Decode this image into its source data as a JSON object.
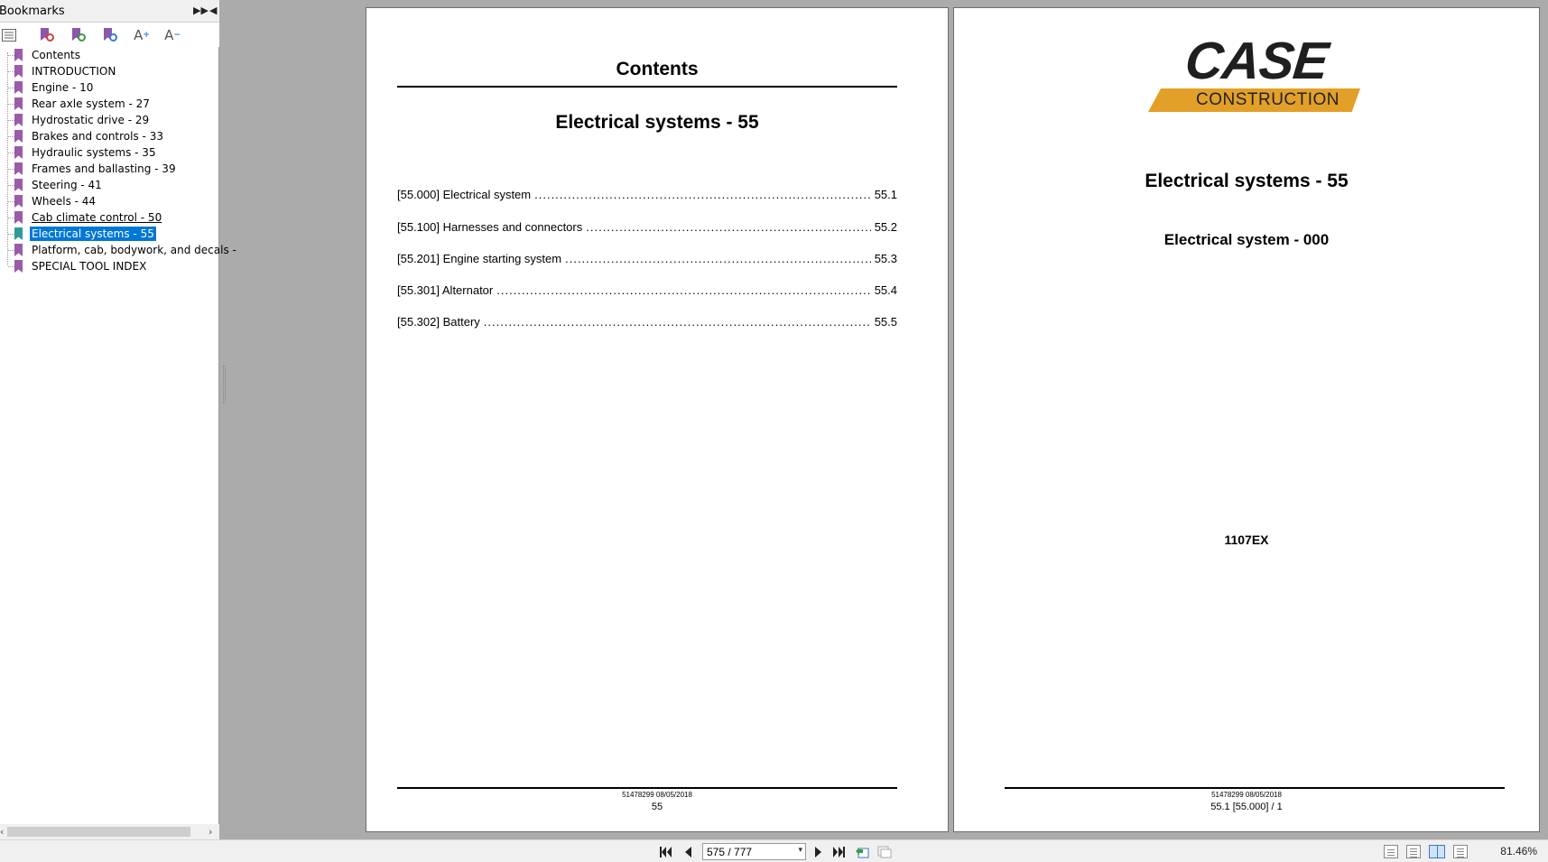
{
  "sidebar": {
    "title": "Bookmarks",
    "items": [
      {
        "label": "Contents"
      },
      {
        "label": "INTRODUCTION"
      },
      {
        "label": "Engine - 10"
      },
      {
        "label": "Rear axle system - 27"
      },
      {
        "label": "Hydrostatic drive - 29"
      },
      {
        "label": "Brakes and controls - 33"
      },
      {
        "label": "Hydraulic systems - 35"
      },
      {
        "label": "Frames and ballasting - 39"
      },
      {
        "label": "Steering - 41"
      },
      {
        "label": "Wheels - 44"
      },
      {
        "label": "Cab climate control - 50"
      },
      {
        "label": "Electrical systems - 55"
      },
      {
        "label": "Platform, cab, bodywork, and decals -"
      },
      {
        "label": "SPECIAL TOOL INDEX"
      }
    ]
  },
  "left_page": {
    "title": "Contents",
    "subtitle": "Electrical systems - 55",
    "toc": [
      {
        "label": "[55.000] Electrical system",
        "page": "55.1"
      },
      {
        "label": "[55.100] Harnesses and connectors",
        "page": "55.2"
      },
      {
        "label": "[55.201] Engine starting system",
        "page": "55.3"
      },
      {
        "label": "[55.301] Alternator",
        "page": "55.4"
      },
      {
        "label": "[55.302] Battery",
        "page": "55.5"
      }
    ],
    "footer_doc": "51478299 08/05/2018",
    "footer_page": "55"
  },
  "right_page": {
    "logo_top": "CASE",
    "logo_bottom": "CONSTRUCTION",
    "title": "Electrical systems - 55",
    "subtitle": "Electrical system - 000",
    "model": "1107EX",
    "footer_doc": "51478299 08/05/2018",
    "footer_page": "55.1 [55.000] / 1"
  },
  "bottombar": {
    "page_value": "575 / 777",
    "zoom": "81.46%"
  },
  "colors": {
    "selection": "#0078d7",
    "bookmark": "#9a5ca8",
    "bookmark_active": "#2c9c9a",
    "logo_band": "#e3a028",
    "workspace": "#ababab"
  }
}
